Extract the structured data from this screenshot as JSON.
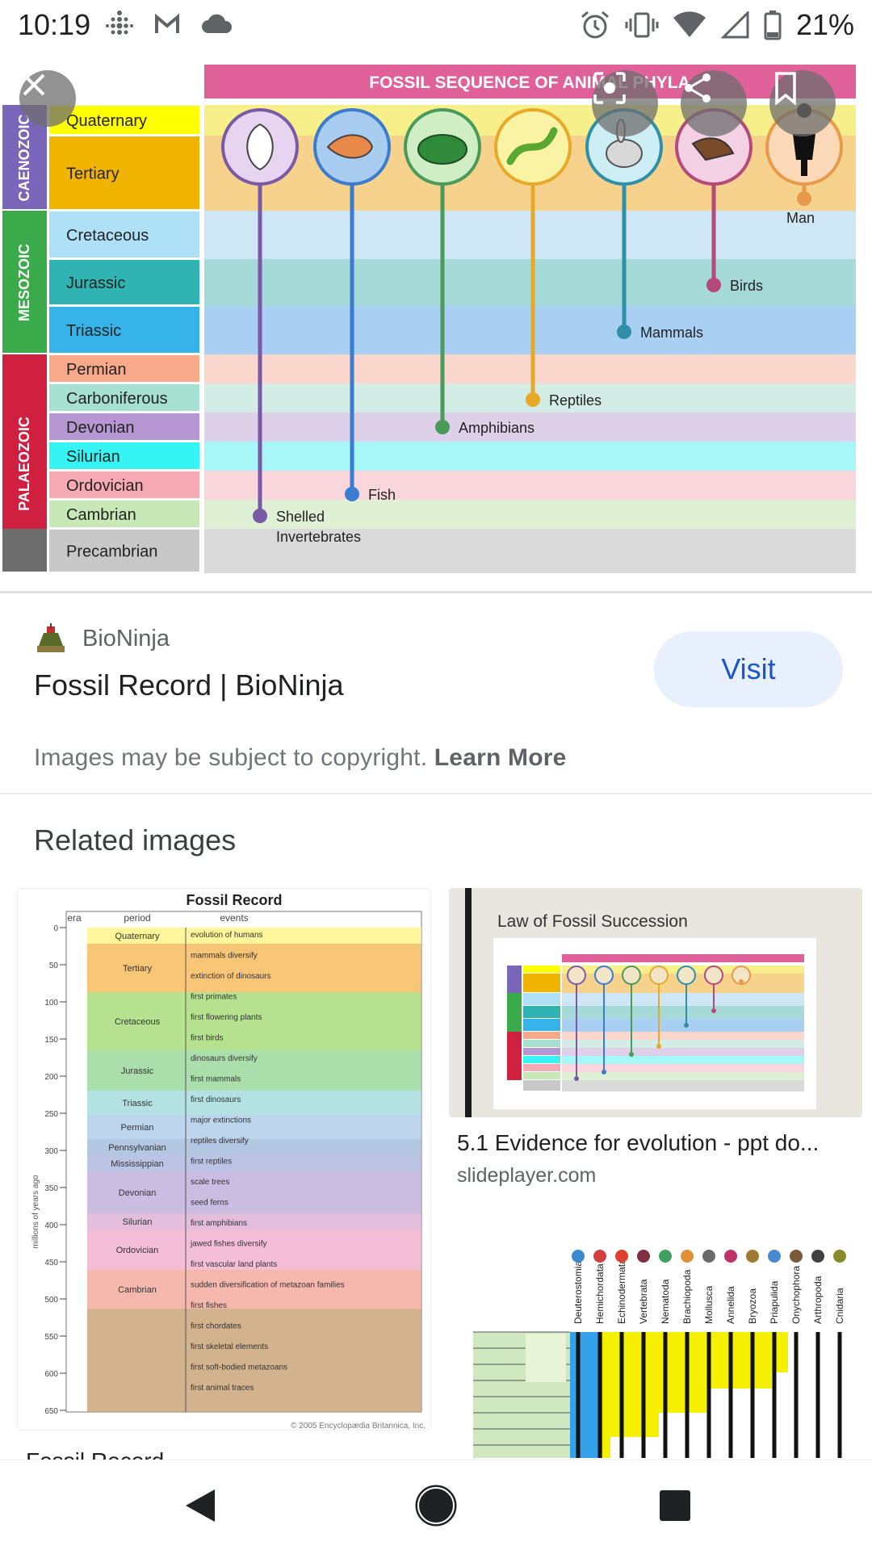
{
  "status_bar": {
    "time": "10:19",
    "battery": "21%",
    "left_icons": [
      "fitbit-icon",
      "gmail-icon",
      "cloud-icon"
    ],
    "right_icons": [
      "alarm-icon",
      "vibrate-icon",
      "wifi-icon",
      "signal-icon",
      "battery-icon"
    ]
  },
  "hero": {
    "title": "FOSSIL SEQUENCE OF ANIMAL PHYLA",
    "eras": [
      "CAENOZOIC",
      "MESOZOIC",
      "PALAEOZOIC"
    ],
    "periods": [
      "Quaternary",
      "Tertiary",
      "Cretaceous",
      "Jurassic",
      "Triassic",
      "Permian",
      "Carboniferous",
      "Devonian",
      "Silurian",
      "Ordovician",
      "Cambrian",
      "Precambrian"
    ],
    "phyla": [
      {
        "label": "Shelled",
        "label2": "Invertebrates",
        "icon": "shell-icon",
        "color": "#7a5aa6",
        "origin_period": "Cambrian"
      },
      {
        "label": "Fish",
        "label2": "",
        "icon": "fish-icon",
        "color": "#3b7bd0",
        "origin_period": "Ordovician"
      },
      {
        "label": "Amphibians",
        "label2": "",
        "icon": "frog-icon",
        "color": "#4a9a5a",
        "origin_period": "Devonian"
      },
      {
        "label": "Reptiles",
        "label2": "",
        "icon": "lizard-icon",
        "color": "#e8a82a",
        "origin_period": "Carboniferous"
      },
      {
        "label": "Mammals",
        "label2": "",
        "icon": "rabbit-icon",
        "color": "#2f8fa8",
        "origin_period": "Triassic"
      },
      {
        "label": "Birds",
        "label2": "",
        "icon": "bird-icon",
        "color": "#b34a7a",
        "origin_period": "Jurassic"
      },
      {
        "label": "Man",
        "label2": "",
        "icon": "human-icon",
        "color": "#e89a4a",
        "origin_period": "Tertiary"
      }
    ],
    "overlay_buttons": [
      "close-icon",
      "lens-icon",
      "share-icon",
      "bookmark-icon"
    ]
  },
  "source": {
    "site": "BioNinja",
    "title": "Fossil Record | BioNinja",
    "visit_label": "Visit",
    "copyright_text": "Images may be subject to copyright.",
    "learn_more": "Learn More"
  },
  "related": {
    "heading": "Related images",
    "items": [
      {
        "caption": "Fossil Record",
        "domain": "",
        "thumb_title": "Fossil Record",
        "thumb_credit": "© 2005 Encyclopædia Britannica, Inc.",
        "thumb_periods": [
          "Quaternary",
          "Tertiary",
          "Cretaceous",
          "Jurassic",
          "Triassic",
          "Permian",
          "Pennsylvanian",
          "Mississippian",
          "Devonian",
          "Silurian",
          "Ordovician",
          "Cambrian"
        ],
        "thumb_events": [
          "evolution of humans",
          "mammals diversify",
          "extinction of dinosaurs",
          "first primates",
          "first flowering plants",
          "first birds",
          "dinosaurs diversify",
          "first mammals",
          "first dinosaurs",
          "major extinctions",
          "reptiles diversify",
          "first reptiles",
          "scale trees",
          "seed ferns",
          "first amphibians",
          "jawed fishes diversify",
          "first vascular land plants",
          "sudden diversification of metazoan families",
          "first fishes",
          "first chordates",
          "first skeletal elements",
          "first soft-bodied metazoans",
          "first animal traces"
        ],
        "thumb_axis": [
          "0",
          "50",
          "100",
          "150",
          "200",
          "250",
          "300",
          "350",
          "400",
          "450",
          "500",
          "550",
          "600",
          "650"
        ],
        "thumb_axis_label": "millions of years ago",
        "thumb_col_headers": [
          "era",
          "period",
          "events"
        ]
      },
      {
        "caption": "5.1 Evidence for evolution - ppt do...",
        "domain": "slideplayer.com",
        "thumb_title": "Law of Fossil Succession"
      },
      {
        "caption": "",
        "domain": "",
        "thumb_labels": [
          "Deuterostomia",
          "Hemichordata",
          "Echinodermata",
          "Vertebrata",
          "Nematoda",
          "Brachiopoda",
          "Mollusca",
          "Annelida",
          "Bryozoa",
          "Priapulida",
          "Onychophora",
          "Arthropoda",
          "Cnidaria"
        ]
      }
    ]
  }
}
